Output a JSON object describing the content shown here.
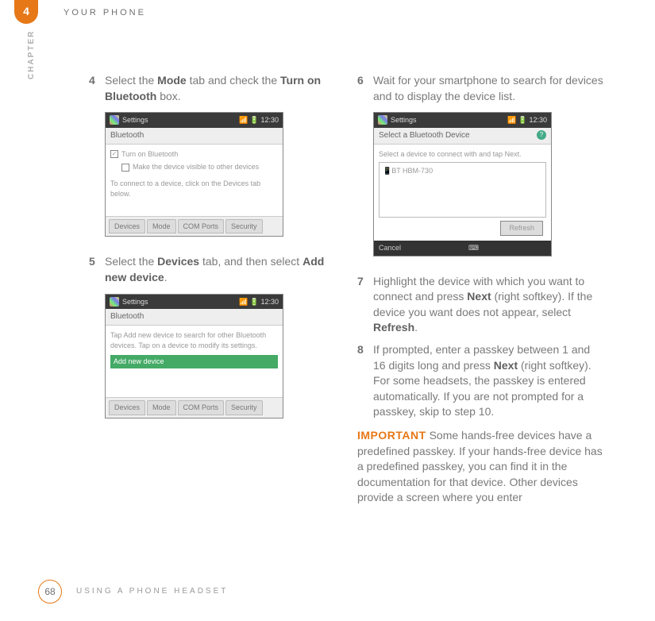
{
  "header": {
    "chapter_number": "4",
    "chapter_title": "YOUR PHONE",
    "sidebar_label": "CHAPTER"
  },
  "steps": {
    "s4": {
      "num": "4",
      "text_before": "Select the ",
      "b1": "Mode",
      "text_mid": " tab and check the ",
      "b2": "Turn on Bluetooth",
      "text_after": " box."
    },
    "s5": {
      "num": "5",
      "text_before": "Select the ",
      "b1": "Devices",
      "text_mid": " tab, and then select ",
      "b2": "Add new device",
      "text_after": "."
    },
    "s6": {
      "num": "6",
      "text": "Wait for your smartphone to search for devices and to display the device list."
    },
    "s7": {
      "num": "7",
      "text_before": "Highlight the device with which you want to connect and press ",
      "b1": "Next",
      "text_mid": " (right softkey). If the device you want does not appear, select ",
      "b2": "Refresh",
      "text_after": "."
    },
    "s8": {
      "num": "8",
      "text_before": "If prompted, enter a passkey between 1 and 16 digits long and press ",
      "b1": "Next",
      "text_after": " (right softkey). For some headsets, the passkey is entered automatically. If you are not prompted for a passkey, skip to step 10."
    }
  },
  "important": {
    "label": "IMPORTANT",
    "text": " Some hands-free devices have a predefined passkey. If your hands-free device has a predefined passkey, you can find it in the documentation for that device. Other devices provide a screen where you enter"
  },
  "screenshots": {
    "s4": {
      "title": "Settings",
      "time": "12:30",
      "subhead": "Bluetooth",
      "chk1": "Turn on Bluetooth",
      "chk2": "Make the device visible to other devices",
      "helptext": "To connect to a device, click on the Devices tab below.",
      "tabs": [
        "Devices",
        "Mode",
        "COM Ports",
        "Security"
      ]
    },
    "s5": {
      "title": "Settings",
      "time": "12:30",
      "subhead": "Bluetooth",
      "helptext": "Tap Add new device to search for other Bluetooth devices. Tap on a device to modify its settings.",
      "selected": "Add new device",
      "tabs": [
        "Devices",
        "Mode",
        "COM Ports",
        "Security"
      ]
    },
    "s6": {
      "title": "Settings",
      "time": "12:30",
      "subhead": "Select a Bluetooth Device",
      "helptext": "Select a device to connect with and tap Next.",
      "list_item": "BT HBM-730",
      "refresh": "Refresh",
      "softkey_left": "Cancel"
    }
  },
  "footer": {
    "page_number": "68",
    "section_title": "USING A PHONE HEADSET"
  }
}
